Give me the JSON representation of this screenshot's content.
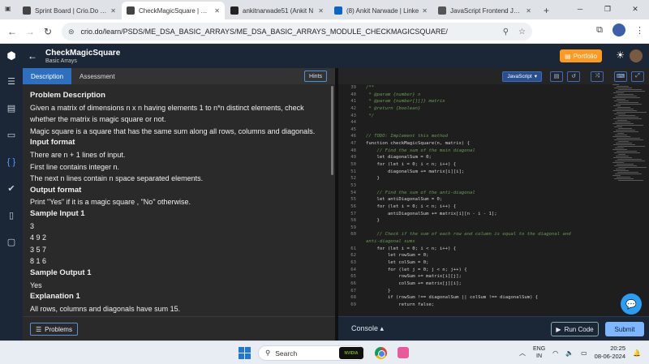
{
  "browser": {
    "tabs": [
      {
        "title": "Sprint Board | Crio.Do | E",
        "fav_color": "#444444",
        "active": false
      },
      {
        "title": "CheckMagicSquare | Basi",
        "fav_color": "#444444",
        "active": true
      },
      {
        "title": "ankitnarwade51 (Ankit N",
        "fav_color": "#222222",
        "active": false
      },
      {
        "title": "(8) Ankit Narwade | Linke",
        "fav_color": "#0a66c2",
        "active": false
      },
      {
        "title": "JavaScript Frontend Jour",
        "fav_color": "#555555",
        "active": false
      }
    ],
    "url": "crio.do/learn/PSDS/ME_DSA_BASIC_ARRAYS/ME_DSA_BASIC_ARRAYS_MODULE_CHECKMAGICSQUARE/"
  },
  "header": {
    "title": "CheckMagicSquare",
    "subtitle": "Basic Arrays",
    "portfolio_label": "Portfolio"
  },
  "problem": {
    "tabs": [
      "Description",
      "Assessment"
    ],
    "hints_label": "Hints",
    "lines": [
      {
        "kind": "h",
        "text": "Problem Description"
      },
      {
        "kind": "l",
        "text": "Given a matrix of dimensions n x n having elements 1 to n*n distinct elements, check"
      },
      {
        "kind": "l",
        "text": "whether the matrix is magic square or not."
      },
      {
        "kind": "l",
        "text": "Magic square is a square that has the same sum along all rows, columns and diagonals."
      },
      {
        "kind": "h",
        "text": "Input format"
      },
      {
        "kind": "l",
        "text": "There are n + 1 lines of input."
      },
      {
        "kind": "l",
        "text": "First line contains integer n."
      },
      {
        "kind": "l",
        "text": "The next n lines contain n space separated elements."
      },
      {
        "kind": "h",
        "text": "Output format"
      },
      {
        "kind": "l",
        "text": "Print \"Yes\" if it is a magic square , \"No\" otherwise."
      },
      {
        "kind": "h",
        "text": "Sample Input 1"
      },
      {
        "kind": "l",
        "text": "3"
      },
      {
        "kind": "l",
        "text": "4 9 2"
      },
      {
        "kind": "l",
        "text": "3 5 7"
      },
      {
        "kind": "l",
        "text": "8 1 6"
      },
      {
        "kind": "h",
        "text": "Sample Output 1"
      },
      {
        "kind": "l",
        "text": "Yes"
      },
      {
        "kind": "h",
        "text": "Explanation 1"
      },
      {
        "kind": "l",
        "text": "All rows, columns and diagonals have sum 15."
      }
    ],
    "problems_label": "Problems"
  },
  "editor": {
    "language": "JavaScript",
    "code": [
      {
        "n": "39",
        "c": "/**",
        "t": "cm"
      },
      {
        "n": "40",
        "c": " * @param {number} n",
        "t": "cm"
      },
      {
        "n": "41",
        "c": " * @param {number[][]} matrix",
        "t": "cm"
      },
      {
        "n": "42",
        "c": " * @return {boolean}",
        "t": "cm"
      },
      {
        "n": "43",
        "c": " */",
        "t": "cm"
      },
      {
        "n": "44",
        "c": "",
        "t": "tx"
      },
      {
        "n": "45",
        "c": "",
        "t": "tx"
      },
      {
        "n": "46",
        "c": "// TODO: Implement this method",
        "t": "cm"
      },
      {
        "n": "47",
        "c": "function checkMagicSquare(n, matrix) {",
        "t": "tx"
      },
      {
        "n": "48",
        "c": "    // Find the sum of the main diagonal",
        "t": "cm"
      },
      {
        "n": "49",
        "c": "    let diagonalSum = 0;",
        "t": "tx"
      },
      {
        "n": "50",
        "c": "    for (let i = 0; i < n; i++) {",
        "t": "tx"
      },
      {
        "n": "51",
        "c": "        diagonalSum += matrix[i][i];",
        "t": "tx"
      },
      {
        "n": "52",
        "c": "    }",
        "t": "tx"
      },
      {
        "n": "53",
        "c": "",
        "t": "tx"
      },
      {
        "n": "54",
        "c": "    // Find the sum of the anti-diagonal",
        "t": "cm"
      },
      {
        "n": "55",
        "c": "    let antiDiagonalSum = 0;",
        "t": "tx"
      },
      {
        "n": "56",
        "c": "    for (let i = 0; i < n; i++) {",
        "t": "tx"
      },
      {
        "n": "57",
        "c": "        antiDiagonalSum += matrix[i][n - i - 1];",
        "t": "tx"
      },
      {
        "n": "58",
        "c": "    }",
        "t": "tx"
      },
      {
        "n": "59",
        "c": "",
        "t": "tx"
      },
      {
        "n": "60",
        "c": "    // Check if the sum of each row and column is equal to the diagonal and",
        "t": "cm"
      },
      {
        "n": "",
        "c": "anti-diagonal sums",
        "t": "cm"
      },
      {
        "n": "61",
        "c": "    for (let i = 0; i < n; i++) {",
        "t": "tx"
      },
      {
        "n": "62",
        "c": "        let rowSum = 0;",
        "t": "tx"
      },
      {
        "n": "63",
        "c": "        let colSum = 0;",
        "t": "tx"
      },
      {
        "n": "64",
        "c": "        for (let j = 0; j < n; j++) {",
        "t": "tx"
      },
      {
        "n": "65",
        "c": "            rowSum += matrix[i][j];",
        "t": "tx"
      },
      {
        "n": "66",
        "c": "            colSum += matrix[j][i];",
        "t": "tx"
      },
      {
        "n": "67",
        "c": "        }",
        "t": "tx"
      },
      {
        "n": "68",
        "c": "        if (rowSum !== diagonalSum || colSum !== diagonalSum) {",
        "t": "tx"
      },
      {
        "n": "69",
        "c": "            return false;",
        "t": "tx"
      }
    ],
    "console_label": "Console",
    "run_label": "Run Code",
    "submit_label": "Submit"
  },
  "taskbar": {
    "search_placeholder": "Search",
    "nvidia_label": "NVIDIA",
    "lang_top": "ENG",
    "lang_bottom": "IN",
    "time": "20:25",
    "date": "08-06-2024"
  }
}
